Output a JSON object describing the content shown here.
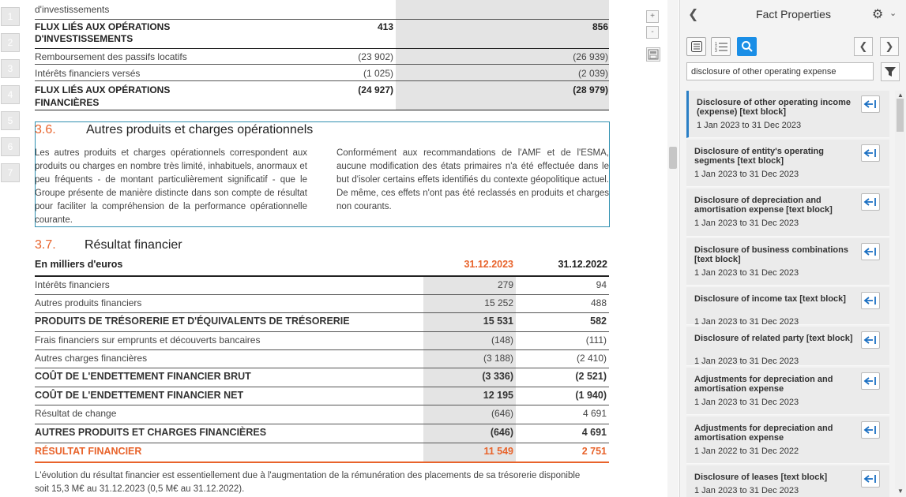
{
  "page_numbers": [
    "1",
    "2",
    "3",
    "4",
    "5",
    "6",
    "7"
  ],
  "doc": {
    "top_fragment": "d'investissements",
    "cashflow_rows": [
      {
        "label": "FLUX LIÉS AUX OPÉRATIONS",
        "label2": "D'INVESTISSEMENTS",
        "v1": "413",
        "v2": "856",
        "bold": true
      },
      {
        "label": "Remboursement des passifs locatifs",
        "v1": "(23 902)",
        "v2": "(26 939)"
      },
      {
        "label": "Intérêts financiers versés",
        "v1": "(1 025)",
        "v2": "(2 039)"
      },
      {
        "label": "FLUX LIÉS AUX OPÉRATIONS",
        "label2": "FINANCIÈRES",
        "v1": "(24 927)",
        "v2": "(28 979)",
        "bold": true
      }
    ],
    "section_36": {
      "number": "3.6.",
      "title": "Autres produits et charges opérationnels",
      "para_left": "Les autres produits et charges opérationnels correspondent aux produits ou charges en nombre très limité, inhabituels, anormaux et peu fréquents - de montant particulièrement significatif - que le Groupe présente de manière distincte dans son compte de résultat pour faciliter la compréhension de la performance opérationnelle courante.",
      "para_right": "Conformément aux recommandations de l'AMF et de l'ESMA, aucune modification des états primaires n'a été effectuée dans le but d'isoler certains effets identifiés du contexte géopolitique actuel. De même, ces effets n'ont pas été reclassés en produits et charges non courants."
    },
    "section_37": {
      "number": "3.7.",
      "title": "Résultat financier",
      "header_label": "En milliers d'euros",
      "col1": "31.12.2023",
      "col2": "31.12.2022",
      "rows": [
        {
          "label": "Intérêts financiers",
          "v1": "279",
          "v2": "94"
        },
        {
          "label": "Autres produits financiers",
          "v1": "15 252",
          "v2": "488"
        },
        {
          "label": "PRODUITS DE TRÉSORERIE ET D'ÉQUIVALENTS DE TRÉSORERIE",
          "v1": "15 531",
          "v2": "582",
          "bold": true
        },
        {
          "label": "Frais financiers sur emprunts et découverts bancaires",
          "v1": "(148)",
          "v2": "(111)"
        },
        {
          "label": "Autres charges financières",
          "v1": "(3 188)",
          "v2": "(2 410)"
        },
        {
          "label": "COÛT DE L'ENDETTEMENT FINANCIER BRUT",
          "v1": "(3 336)",
          "v2": "(2 521)",
          "bold": true
        },
        {
          "label": "COÛT DE L'ENDETTEMENT FINANCIER NET",
          "v1": "12 195",
          "v2": "(1 940)",
          "bold": true
        },
        {
          "label": "Résultat de change",
          "v1": "(646)",
          "v2": "4 691"
        },
        {
          "label": "AUTRES PRODUITS ET CHARGES FINANCIÈRES",
          "v1": "(646)",
          "v2": "4 691",
          "bold": true
        },
        {
          "label": "RÉSULTAT FINANCIER",
          "v1": "11 549",
          "v2": "2 751",
          "bold": true,
          "orange": true
        }
      ],
      "footnote_line1": "L'évolution du résultat financier est essentiellement due à l'augmentation de la rémunération des placements de sa trésorerie disponible",
      "footnote_line2": "soit 15,3 M€ au 31.12.2023 (0,5 M€ au 31.12.2022)."
    }
  },
  "doc_tools": {
    "zoom_in": "+",
    "zoom_out": "-"
  },
  "panel": {
    "title": "Fact Properties",
    "search_value": "disclosure of other operating expense",
    "facts": [
      {
        "title": "Disclosure of other operating income (expense) [text block]",
        "date": "1 Jan 2023 to 31 Dec 2023"
      },
      {
        "title": "Disclosure of entity's operating segments [text block]",
        "date": "1 Jan 2023 to 31 Dec 2023"
      },
      {
        "title": "Disclosure of depreciation and amortisation expense [text block]",
        "date": "1 Jan 2023 to 31 Dec 2023"
      },
      {
        "title": "Disclosure of business combinations [text block]",
        "date": "1 Jan 2023 to 31 Dec 2023"
      },
      {
        "title": "Disclosure of income tax [text block]",
        "date": "1 Jan 2023 to 31 Dec 2023"
      },
      {
        "title": "Disclosure of related party [text block]",
        "date": "1 Jan 2023 to 31 Dec 2023"
      },
      {
        "title": "Adjustments for depreciation and amortisation expense",
        "date": "1 Jan 2023 to 31 Dec 2023"
      },
      {
        "title": "Adjustments for depreciation and amortisation expense",
        "date": "1 Jan 2022 to 31 Dec 2022"
      },
      {
        "title": "Disclosure of leases [text block]",
        "date": "1 Jan 2023 to 31 Dec 2023"
      }
    ]
  },
  "colors": {
    "accent_orange": "#e8632b",
    "accent_blue": "#1a8ee6",
    "section_border": "#2f8fb0"
  },
  "icons": [
    "back-icon",
    "gear-icon",
    "chevron-down-icon",
    "text-view-icon",
    "list-view-icon",
    "search-icon",
    "prev-icon",
    "next-icon",
    "filter-icon",
    "goto-fact-icon",
    "save-icon"
  ]
}
